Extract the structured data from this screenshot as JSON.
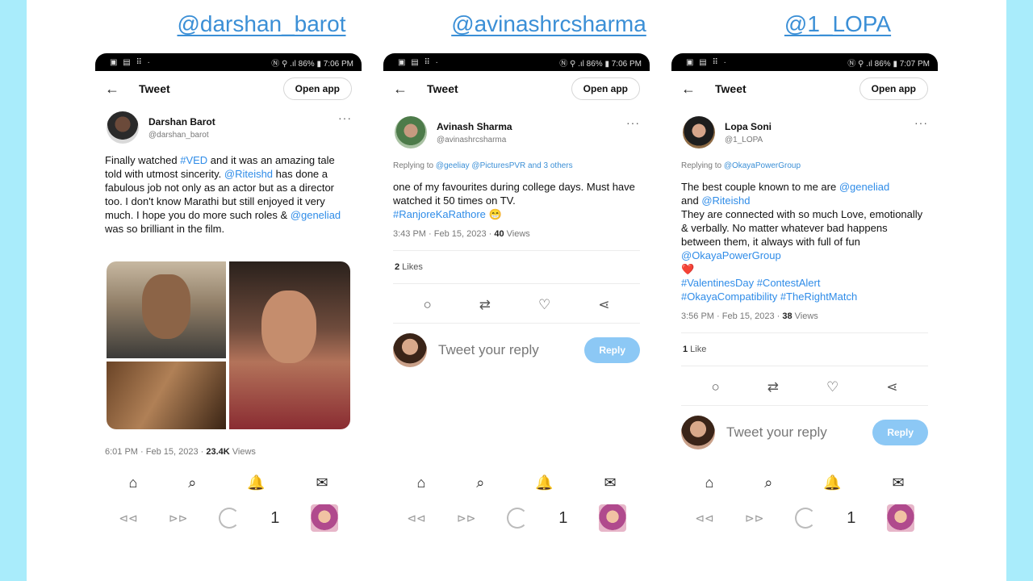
{
  "handles": [
    "@darshan_barot",
    "@avinashrcsharma",
    "@1_LOPA"
  ],
  "common": {
    "tweet_label": "Tweet",
    "open_app": "Open app",
    "reply_placeholder": "Tweet your reply",
    "reply_button": "Reply",
    "tab_count": "1"
  },
  "phones": [
    {
      "status_right": "Ⓝ ⚲ .ıl 86% ▮ 7:06 PM",
      "name": "Darshan Barot",
      "handle": "@darshan_barot",
      "body_line1": "Finally watched ",
      "body_tag1": "#VED",
      "body_line2": " and it was an amazing tale told with utmost sincerity. ",
      "body_mention1": "@Riteishd",
      "body_line3": " has done a fabulous job not only as an actor but as a director too. I don't know Marathi but still enjoyed it very much. I hope you do more such roles & ",
      "body_mention2": "@geneliad",
      "body_line4": " was so brilliant in the film.",
      "meta_time": "6:01 PM · Feb 15, 2023 · ",
      "meta_views_num": "23.4K",
      "meta_views_label": " Views"
    },
    {
      "status_right": "Ⓝ ⚲ .ıl 86% ▮ 7:06 PM",
      "name": "Avinash Sharma",
      "handle": "@avinashrcsharma",
      "replying_prefix": "Replying to ",
      "replying_to": "@geeliay @PicturesPVR and 3 others",
      "body_text": "one of my favourites during college days. Must have watched it 50 times on TV.",
      "body_tag": "#RanjoreKaRathore",
      "body_emoji": "😁",
      "meta_time": "3:43 PM · Feb 15, 2023 · ",
      "meta_views_num": "40",
      "meta_views_label": " Views",
      "likes_num": "2",
      "likes_label": " Likes"
    },
    {
      "status_right": "Ⓝ ⚲ .ıl 86% ▮ 7:07 PM",
      "name": "Lopa Soni",
      "handle": "@1_LOPA",
      "replying_prefix": "Replying to ",
      "replying_to": "@OkayaPowerGroup",
      "body_intro": "The best couple known to me are ",
      "body_mention1": "@geneliad",
      "body_and": " and ",
      "body_mention2": "@Riteishd",
      "body_text": " They are connected with so much Love, emotionally & verbally. No matter whatever bad happens between them, it always with full of fun",
      "body_mention3": "@OkayaPowerGroup",
      "body_heart": "❤️",
      "body_tags1": "#ValentinesDay #ContestAlert",
      "body_tags2": "#OkayaCompatibility #TheRightMatch",
      "meta_time": "3:56 PM · Feb 15, 2023 · ",
      "meta_views_num": "38",
      "meta_views_label": " Views",
      "likes_num": "1",
      "likes_label": " Like"
    }
  ],
  "icons": {
    "back": "←",
    "more": "···",
    "reply": "○",
    "retweet": "⇄",
    "like": "♡",
    "share": "⋖",
    "home": "⌂",
    "search": "⌕",
    "bell": "🔔",
    "mail": "✉",
    "browser_back": "⊲⊲",
    "browser_forward": "⊳⊳"
  }
}
